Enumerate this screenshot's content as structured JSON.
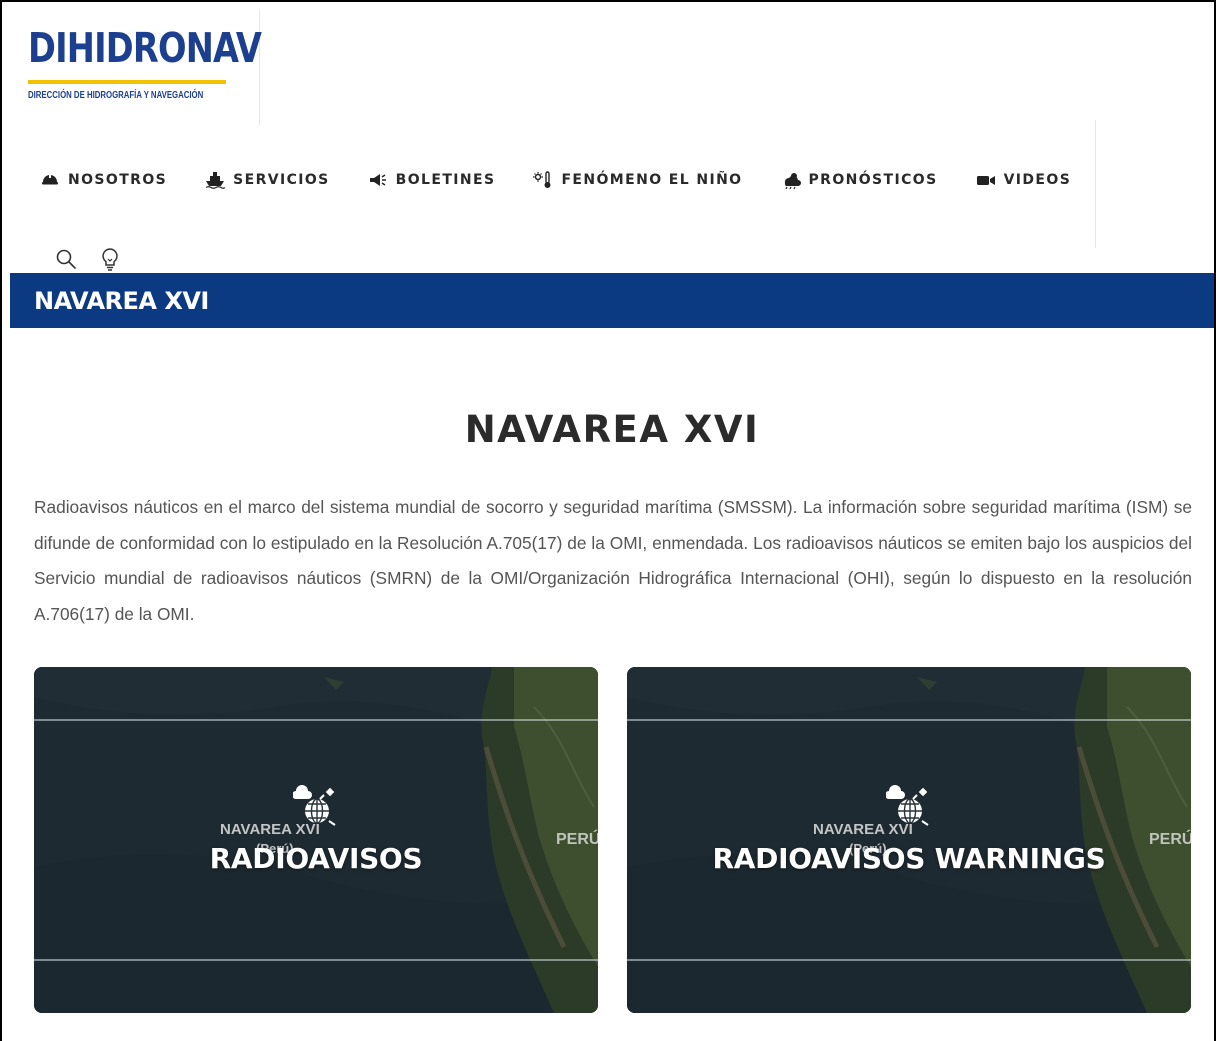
{
  "header": {
    "logo_title": "DIHIDRONAV",
    "logo_subtitle": "DIRECCIÓN DE HIDROGRAFÍA Y NAVEGACIÓN",
    "brand_colors": {
      "primary": "#1d3f8f",
      "accent": "#f2c200",
      "titlebar": "#0b3a82"
    }
  },
  "nav": {
    "items": [
      {
        "label": "NOSOTROS",
        "icon": "hard-hat-icon"
      },
      {
        "label": "SERVICIOS",
        "icon": "ship-icon"
      },
      {
        "label": "BOLETINES",
        "icon": "megaphone-icon"
      },
      {
        "label": "FENÓMENO EL NIÑO",
        "icon": "thermometer-sun-icon"
      },
      {
        "label": "PRONÓSTICOS",
        "icon": "cloud-sun-rain-icon"
      },
      {
        "label": "VIDEOS",
        "icon": "video-camera-icon"
      }
    ],
    "tools": [
      {
        "icon": "search-icon"
      },
      {
        "icon": "lightbulb-icon"
      }
    ]
  },
  "titlebar": {
    "text": "NAVAREA XVI"
  },
  "main": {
    "title": "NAVAREA XVI",
    "intro": "Radioavisos náuticos en el marco del sistema mundial de socorro y seguridad marítima (SMSSM). La información sobre seguridad marítima (ISM) se difunde de conformidad con lo estipulado en la Resolución A.705(17) de la OMI, enmendada. Los radioavisos náuticos se emiten bajo los auspicios del Servicio mundial de radioavisos náuticos (SMRN) de la OMI/Organización Hidrográfica Internacional (OHI), según lo dispuesto en la resolución A.706(17) de la OMI.",
    "cards": [
      {
        "label": "RADIOAVISOS",
        "map_tag": "NAVAREA XVI",
        "map_sub": "(Perú)",
        "map_country": "PERÚ",
        "icon": "satellite-globe-icon"
      },
      {
        "label": "RADIOAVISOS WARNINGS",
        "map_tag": "NAVAREA XVI",
        "map_sub": "(Perú)",
        "map_country": "PERÚ",
        "icon": "satellite-globe-icon"
      }
    ]
  }
}
